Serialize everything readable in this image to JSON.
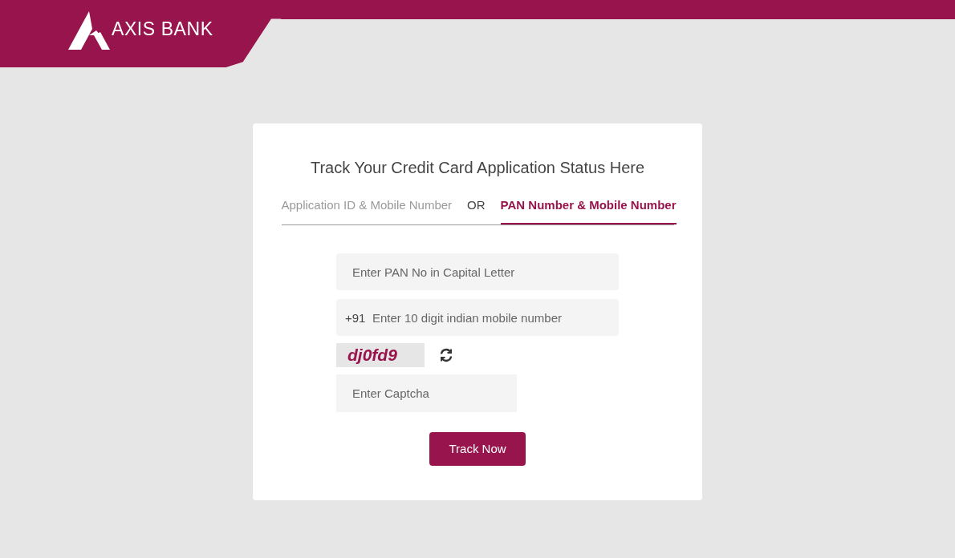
{
  "header": {
    "logo_text": "AXIS BANK"
  },
  "card": {
    "title": "Track Your Credit Card Application Status Here",
    "tabs": [
      {
        "label": "Application ID & Mobile Number",
        "selected": false
      },
      {
        "label": "PAN Number & Mobile Number",
        "selected": true
      }
    ],
    "tab_separator": "OR",
    "pan_field": {
      "placeholder": "Enter PAN No in Capital Letter"
    },
    "mobile_field": {
      "prefix": "+91",
      "placeholder": "Enter 10 digit indian mobile number"
    },
    "captcha": {
      "text": "dj0fd9"
    },
    "captcha_field": {
      "placeholder": "Enter Captcha"
    },
    "submit": "Track Now"
  }
}
